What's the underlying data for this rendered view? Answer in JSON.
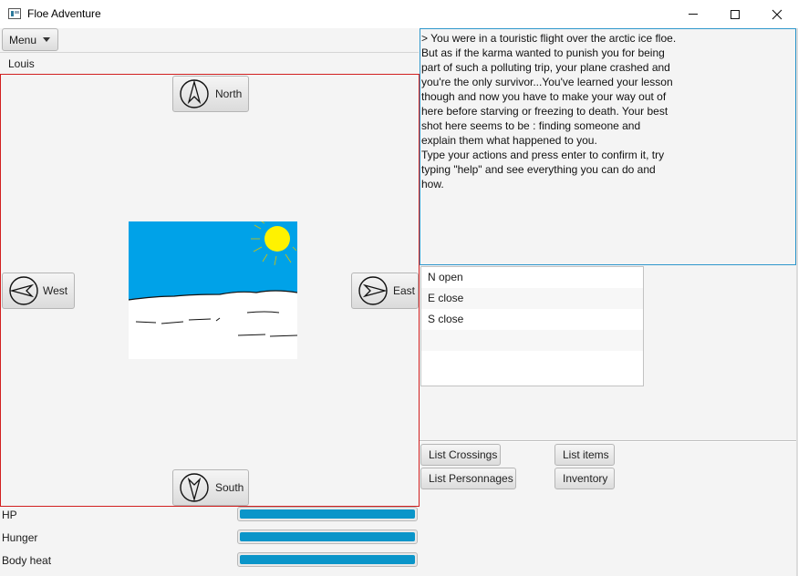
{
  "window": {
    "title": "Floe Adventure"
  },
  "menu": {
    "label": "Menu"
  },
  "player": {
    "name": "Louis"
  },
  "directions": {
    "north": "North",
    "west": "West",
    "east": "East",
    "south": "South"
  },
  "stats": [
    {
      "label": "HP",
      "value": 1.0
    },
    {
      "label": "Hunger",
      "value": 1.0
    },
    {
      "label": "Body heat",
      "value": 1.0
    }
  ],
  "log": {
    "text": "> You were in a touristic flight over the arctic ice floe. But as if the karma wanted to punish you for being part of such a polluting trip, your plane crashed and you're the only survivor...You've learned your lesson though and now you have to make your way out of here before starving or freezing to death. Your best shot here seems to be : finding someone and explain them what happened to you.\nType your actions and press enter to confirm it, try typing \"help\" and see everything you can do and how."
  },
  "crossings": [
    "N open",
    "E close",
    "S close",
    "",
    ""
  ],
  "actions": {
    "list_crossings": "List Crossings",
    "list_items": "List items",
    "list_personnages": "List Personnages",
    "inventory": "Inventory"
  },
  "colors": {
    "bar": "#0a95c9",
    "scene_border": "#d11f1f",
    "log_border": "#2f97cc",
    "sky": "#00a2e8",
    "sun": "#fff200"
  }
}
